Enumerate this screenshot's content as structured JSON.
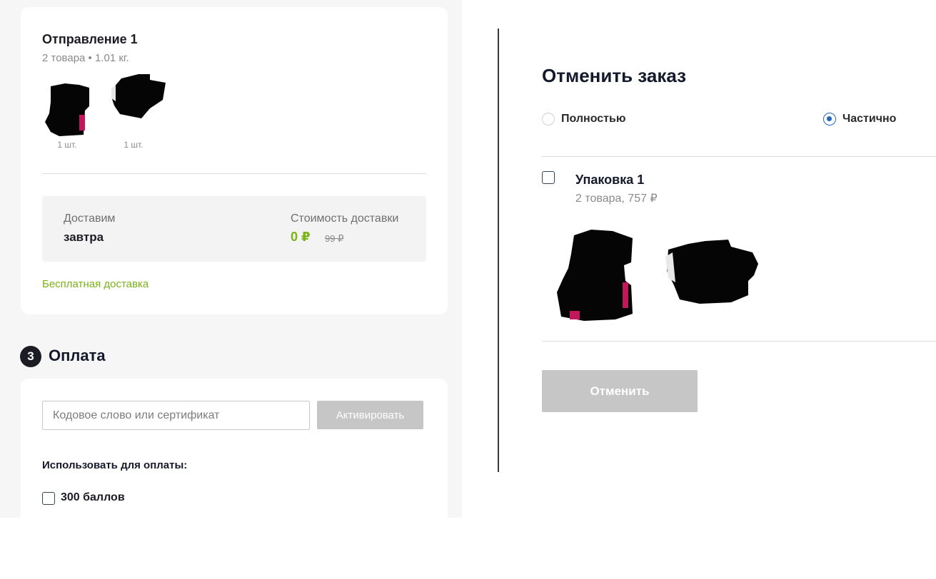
{
  "shipment": {
    "title": "Отправление 1",
    "subtitle": "2 товара • 1.01 кг.",
    "items": [
      {
        "qty": "1 шт.",
        "icon": "product-thumbnail-redacted"
      },
      {
        "qty": "1 шт.",
        "icon": "product-thumbnail-redacted"
      }
    ],
    "delivery_label": "Доставим",
    "delivery_value": "завтра",
    "cost_label": "Стоимость доставки",
    "cost_price": "0 ₽",
    "cost_old": "99 ₽",
    "free_delivery_link": "Бесплатная доставка"
  },
  "payment": {
    "step_number": "3",
    "title": "Оплата",
    "promo_placeholder": "Кодовое слово или сертификат",
    "activate_label": "Активировать",
    "use_for_payment_label": "Использовать для оплаты:",
    "bonus_label": "300 баллов"
  },
  "cancel_modal": {
    "title": "Отменить заказ",
    "options": [
      {
        "label": "Полностью",
        "selected": false
      },
      {
        "label": "Частично",
        "selected": true
      }
    ],
    "package": {
      "title": "Упаковка 1",
      "subtitle": "2 товара, 757 ₽"
    },
    "cancel_label": "Отменить"
  },
  "colors": {
    "accent_green": "#7ab317",
    "radio_blue": "#2466b8",
    "disabled_button": "#c6c6c6",
    "dark_text": "#14192b"
  }
}
